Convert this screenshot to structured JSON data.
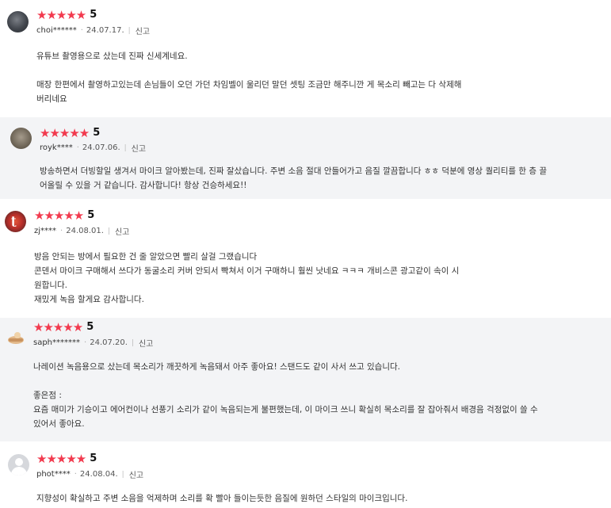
{
  "reviews": [
    {
      "stars": "★★★★★",
      "score": "5",
      "user": "choi******",
      "date": "24.07.17.",
      "report": "신고",
      "lines": [
        "유튜브 촬영용으로 샀는데 진짜 신세계네요.",
        "",
        "매장 한편에서 촬영하고있는데 손님들이 오던 가던 차임벨이 울리던 말던 셋팅 조금만 해주니깐 게 목소리 빼고는 다 삭제해",
        "버리네요"
      ]
    },
    {
      "stars": "★★★★★",
      "score": "5",
      "user": "royk****",
      "date": "24.07.06.",
      "report": "신고",
      "lines": [
        "방송하면서 더빙할일 생겨서 마이크 알아봤는데, 진짜 잘샀습니다. 주변 소음 절대 안들어가고 음질 깔끔합니다 ㅎㅎ 덕분에 영상 퀄리티를 한 층 끌",
        "어올릴 수 있을 거 같습니다. 감사합니다! 항상 건승하세요!!"
      ]
    },
    {
      "stars": "★★★★★",
      "score": "5",
      "user": "zj****",
      "date": "24.08.01.",
      "report": "신고",
      "lines": [
        "방음 안되는 방에서 필요한 건 줄 알았으면 빨리 살걸 그랬습니다",
        "콘덴서 마이크 구매해서 쓰다가 동굴소리 커버 안되서 빡쳐서 이거 구매하니 훨씬 낫네요 ㅋㅋㅋ 개비스콘 광고같이 속이 시",
        "원합니다.",
        "재밌게 녹음 할게요 감사합니다."
      ]
    },
    {
      "stars": "★★★★★",
      "score": "5",
      "user": "saph*******",
      "date": "24.07.20.",
      "report": "신고",
      "lines": [
        "나레이션 녹음용으로 샀는데 목소리가 깨끗하게 녹음돼서 아주 좋아요! 스탠드도 같이 사서 쓰고 있습니다.",
        "",
        "좋은점 :",
        "요즘 매미가 기승이고 에어컨이나 선풍기 소리가 같이 녹음되는게 불편했는데, 이 마이크 쓰니 확실히 목소리를 잘 잡아줘서 배경음 걱정없이 쓸 수",
        "있어서 좋아요."
      ]
    },
    {
      "stars": "★★★★★",
      "score": "5",
      "user": "phot****",
      "date": "24.08.04.",
      "report": "신고",
      "lines": [
        "지향성이 확실하고 주변 소음을 억제하며 소리를 확 빨아 들이는듯한 음질에 원하던 스타일의 마이크입니다."
      ]
    }
  ]
}
